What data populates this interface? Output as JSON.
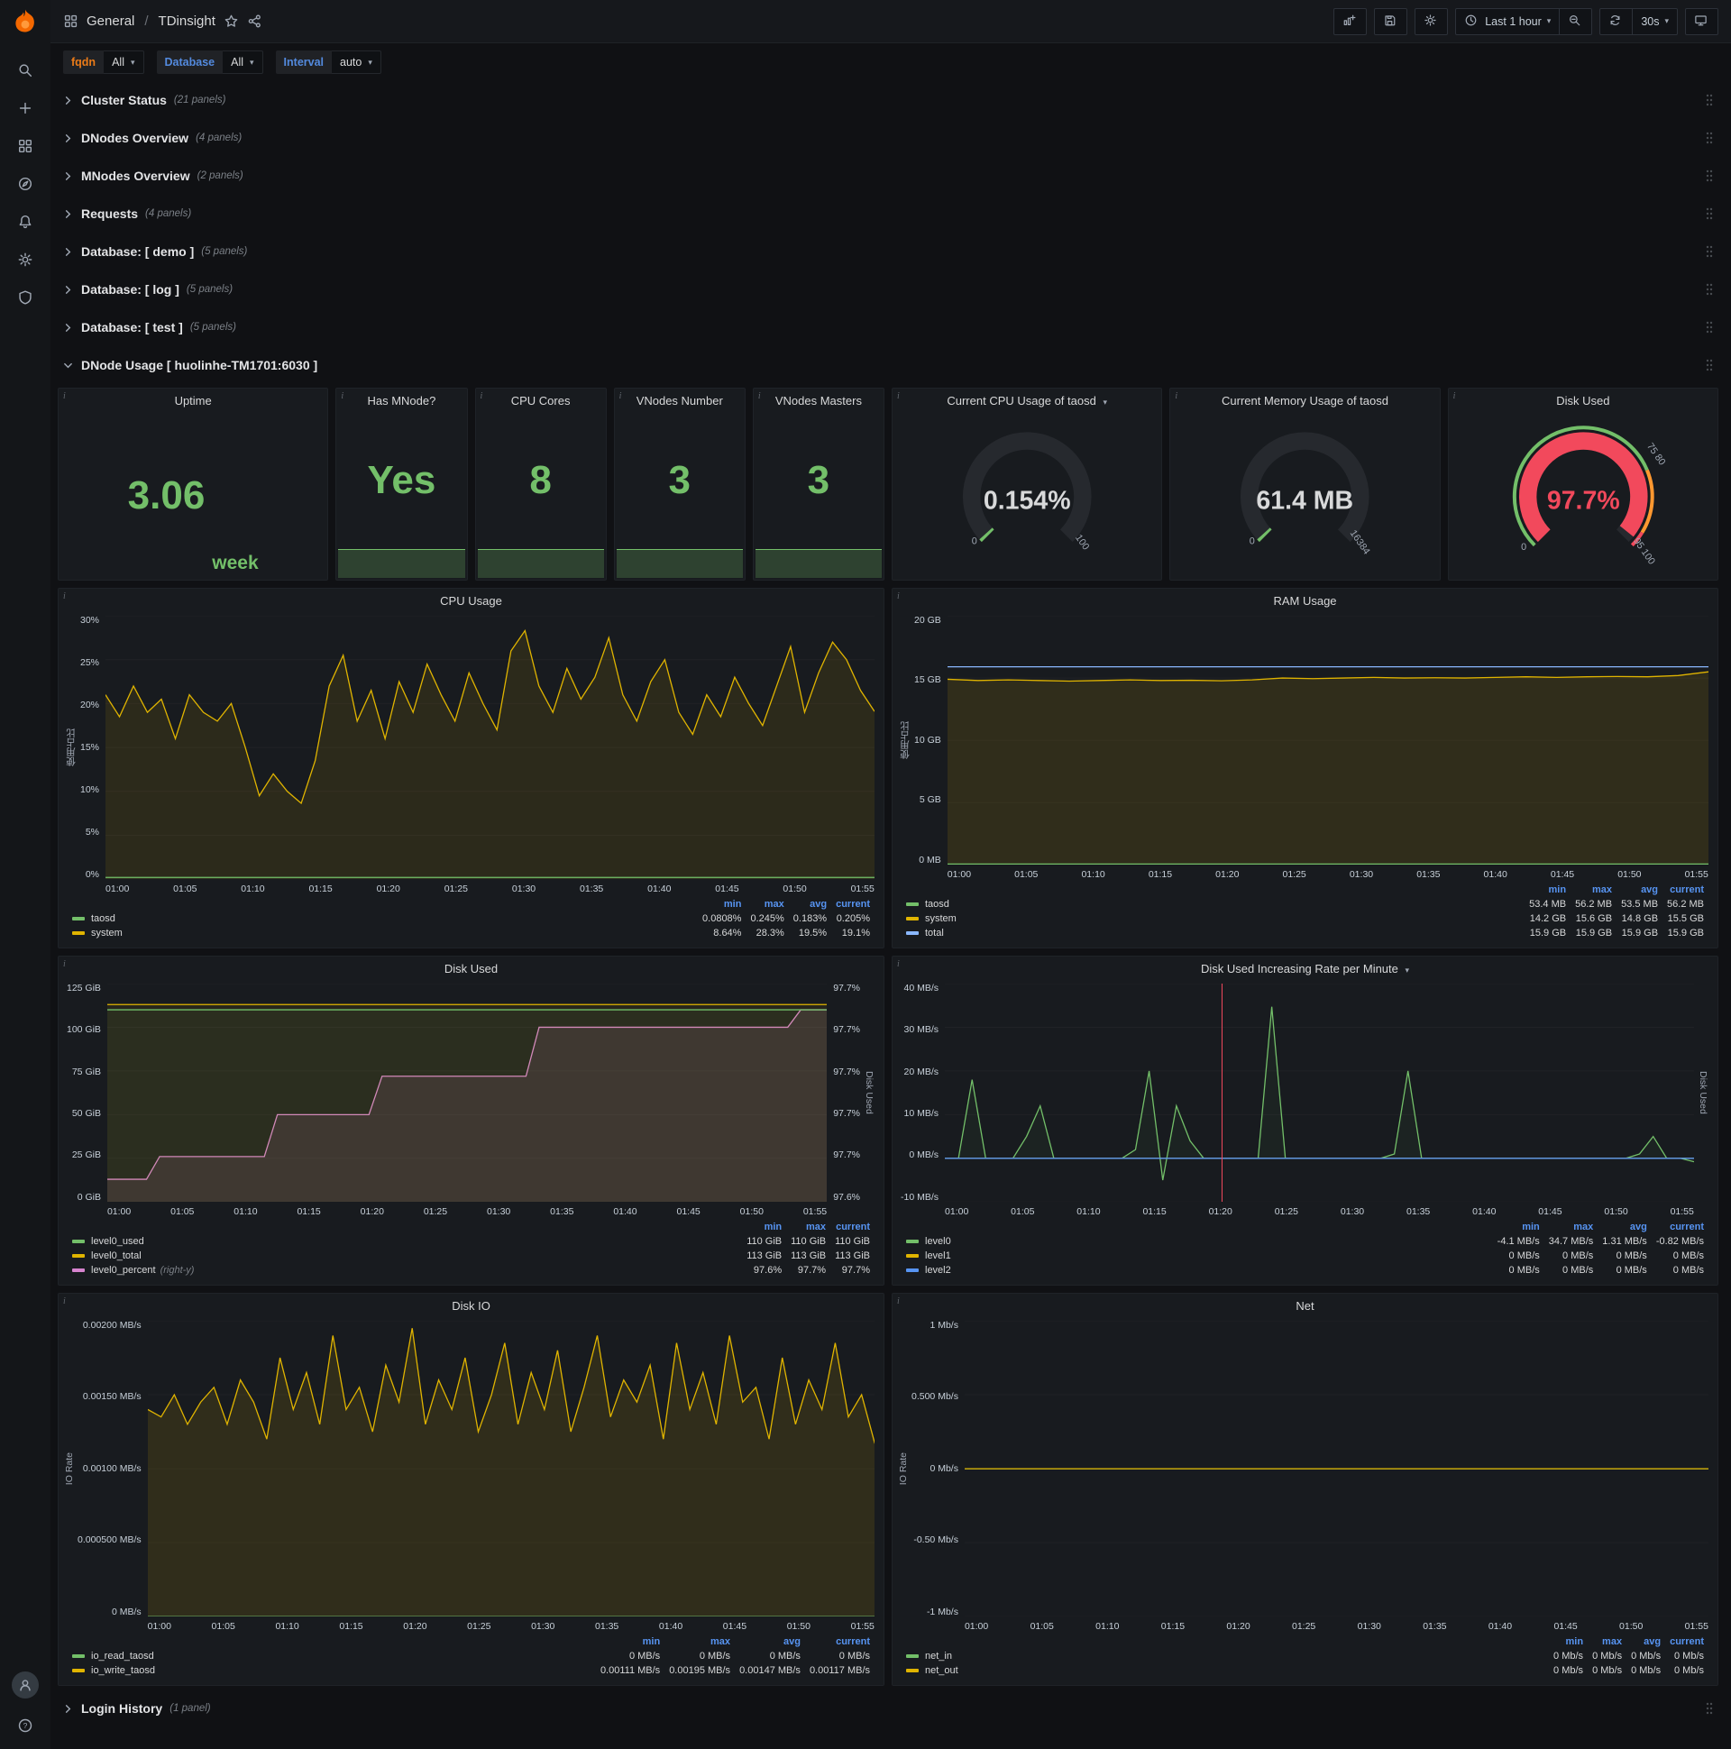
{
  "nav": {
    "section": "General",
    "separator": "/",
    "title": "TDinsight",
    "time_label": "Last 1 hour",
    "refresh_label": "30s"
  },
  "variables": [
    {
      "label": "fqdn",
      "value": "All",
      "color": "#eb7b18"
    },
    {
      "label": "Database",
      "value": "All",
      "color": "#538ade"
    },
    {
      "label": "Interval",
      "value": "auto",
      "color": "#538ade"
    }
  ],
  "sidebar": {
    "top": [
      "search",
      "plus",
      "apps",
      "compass",
      "bell",
      "cog",
      "shield"
    ],
    "bottom": [
      "user",
      "help"
    ]
  },
  "dashboard_rows": [
    {
      "title": "Cluster Status",
      "count": "(21 panels)"
    },
    {
      "title": "DNodes Overview",
      "count": "(4 panels)"
    },
    {
      "title": "MNodes Overview",
      "count": "(2 panels)"
    },
    {
      "title": "Requests",
      "count": "(4 panels)"
    },
    {
      "title": "Database: [ demo ]",
      "count": "(5 panels)"
    },
    {
      "title": "Database: [ log ]",
      "count": "(5 panels)"
    },
    {
      "title": "Database: [ test ]",
      "count": "(5 panels)"
    }
  ],
  "dnode_row": {
    "title": "DNode Usage [ huolinhe-TM1701:6030 ]"
  },
  "login_row": {
    "title": "Login History",
    "count": "(1 panel)"
  },
  "stats": [
    {
      "title": "Uptime",
      "value": "3.06",
      "unit": "week",
      "bar": false
    },
    {
      "title": "Has MNode?",
      "value": "Yes",
      "unit": "",
      "bar": true
    },
    {
      "title": "CPU Cores",
      "value": "8",
      "unit": "",
      "bar": true
    },
    {
      "title": "VNodes Number",
      "value": "3",
      "unit": "",
      "bar": true
    },
    {
      "title": "VNodes Masters",
      "value": "3",
      "unit": "",
      "bar": true
    }
  ],
  "gauges": [
    {
      "title": "Current CPU Usage of taosd",
      "caret": true,
      "value": "0.154%",
      "min_label": "0",
      "max_label": "100",
      "pct": 0.0016,
      "arc_color": "#73bf69",
      "text_color": "#d8d9da",
      "outer": false,
      "threshold_label_mid": "",
      "threshold_label_end": ""
    },
    {
      "title": "Current Memory Usage of taosd",
      "caret": false,
      "value": "61.4 MB",
      "min_label": "0",
      "max_label": "16384",
      "pct": 0.0038,
      "arc_color": "#73bf69",
      "text_color": "#d8d9da",
      "outer": false,
      "threshold_label_mid": "",
      "threshold_label_end": ""
    },
    {
      "title": "Disk Used",
      "caret": false,
      "value": "97.7%",
      "min_label": "0",
      "max_label": "",
      "pct": 0.977,
      "arc_color": "#f2495c",
      "text_color": "#f2495c",
      "outer": true,
      "threshold_label_mid": "75 80",
      "threshold_label_end": "95 100"
    }
  ],
  "x_ticks": [
    "01:00",
    "01:05",
    "01:10",
    "01:15",
    "01:20",
    "01:25",
    "01:30",
    "01:35",
    "01:40",
    "01:45",
    "01:50",
    "01:55"
  ],
  "charts": [
    {
      "title": "CPU Usage",
      "caret": false,
      "y_label": "使用占比",
      "y2_label": "",
      "y_ticks": [
        "30%",
        "25%",
        "20%",
        "15%",
        "10%",
        "5%",
        "0%"
      ],
      "ymin": 0,
      "ymax": 30,
      "series": [
        {
          "name": "system",
          "color": "#e0b400",
          "fill": 0.1,
          "values": [
            21,
            18.5,
            22,
            19,
            20.5,
            16,
            21,
            19,
            18,
            20,
            15,
            9.5,
            12,
            10,
            8.64,
            13.5,
            22,
            25.5,
            18,
            21.5,
            16,
            22.5,
            19,
            24.5,
            21,
            18,
            23.5,
            20,
            17,
            26,
            28.3,
            22,
            19,
            24,
            20.5,
            23,
            27.5,
            21,
            18,
            22.5,
            25,
            19,
            16.5,
            21,
            18.5,
            23,
            20,
            17.5,
            22,
            26.5,
            19,
            23.5,
            27,
            25,
            21.5,
            19.1
          ]
        },
        {
          "name": "taosd",
          "color": "#73bf69",
          "fill": 0.06,
          "values": [
            0.2,
            0.2
          ]
        }
      ],
      "legend": {
        "cols": [
          "min",
          "max",
          "avg",
          "current"
        ],
        "rows": [
          {
            "name": "taosd",
            "color": "#73bf69",
            "suffix": "",
            "values": [
              "0.0808%",
              "0.245%",
              "0.183%",
              "0.205%"
            ]
          },
          {
            "name": "system",
            "color": "#e0b400",
            "suffix": "",
            "values": [
              "8.64%",
              "28.3%",
              "19.5%",
              "19.1%"
            ]
          }
        ]
      }
    },
    {
      "title": "RAM Usage",
      "caret": false,
      "y_label": "使用占比",
      "y2_label": "",
      "y_ticks": [
        "20 GB",
        "15 GB",
        "10 GB",
        "5 GB",
        "0 MB"
      ],
      "ymin": 0,
      "ymax": 20,
      "series": [
        {
          "name": "system",
          "color": "#e0b400",
          "fill": 0.12,
          "values": [
            14.9,
            14.8,
            14.85,
            14.8,
            14.75,
            14.8,
            14.85,
            14.8,
            14.82,
            14.78,
            14.85,
            15,
            14.95,
            15,
            15.05,
            15,
            15.02,
            15,
            15.05,
            15.1,
            15.05,
            15.1,
            15.12,
            15.1,
            15.2,
            15.5
          ]
        },
        {
          "name": "taosd",
          "color": "#73bf69",
          "fill": 0,
          "values": [
            0.06,
            0.06
          ]
        },
        {
          "name": "total",
          "color": "#8ab8ff",
          "fill": 0,
          "values": [
            15.9,
            15.9
          ]
        }
      ],
      "legend": {
        "cols": [
          "min",
          "max",
          "avg",
          "current"
        ],
        "rows": [
          {
            "name": "taosd",
            "color": "#73bf69",
            "suffix": "",
            "values": [
              "53.4 MB",
              "56.2 MB",
              "53.5 MB",
              "56.2 MB"
            ]
          },
          {
            "name": "system",
            "color": "#e0b400",
            "suffix": "",
            "values": [
              "14.2 GB",
              "15.6 GB",
              "14.8 GB",
              "15.5 GB"
            ]
          },
          {
            "name": "total",
            "color": "#8ab8ff",
            "suffix": "",
            "values": [
              "15.9 GB",
              "15.9 GB",
              "15.9 GB",
              "15.9 GB"
            ]
          }
        ]
      }
    },
    {
      "title": "Disk Used",
      "caret": false,
      "y_label": "",
      "y2_label": "Disk Used",
      "y_ticks": [
        "125 GiB",
        "100 GiB",
        "75 GiB",
        "50 GiB",
        "25 GiB",
        "0 GiB"
      ],
      "y2_ticks": [
        "97.7%",
        "97.7%",
        "97.7%",
        "97.7%",
        "97.7%",
        "97.6%"
      ],
      "ymin": 0,
      "ymax": 125,
      "series": [
        {
          "name": "level0_percent",
          "color": "#d683ce",
          "fill": 0.12,
          "values": [
            13,
            13,
            13,
            13,
            26,
            26,
            26,
            26,
            26,
            26,
            26,
            26,
            26,
            50,
            50,
            50,
            50,
            50,
            50,
            50,
            50,
            72,
            72,
            72,
            72,
            72,
            72,
            72,
            72,
            72,
            72,
            72,
            72,
            100,
            100,
            100,
            100,
            100,
            100,
            100,
            100,
            100,
            100,
            100,
            100,
            100,
            100,
            100,
            100,
            100,
            100,
            100,
            100,
            110,
            110,
            110
          ]
        },
        {
          "name": "level0_total",
          "color": "#e0b400",
          "fill": 0.08,
          "values": [
            113,
            113
          ]
        },
        {
          "name": "level0_used",
          "color": "#73bf69",
          "fill": 0.05,
          "values": [
            110,
            110
          ]
        }
      ],
      "legend": {
        "cols": [
          "min",
          "max",
          "current"
        ],
        "rows": [
          {
            "name": "level0_used",
            "color": "#73bf69",
            "suffix": "",
            "values": [
              "110 GiB",
              "110 GiB",
              "110 GiB"
            ]
          },
          {
            "name": "level0_total",
            "color": "#e0b400",
            "suffix": "",
            "values": [
              "113 GiB",
              "113 GiB",
              "113 GiB"
            ]
          },
          {
            "name": "level0_percent",
            "color": "#d683ce",
            "suffix": "(right-y)",
            "values": [
              "97.6%",
              "97.7%",
              "97.7%"
            ]
          }
        ]
      }
    },
    {
      "title": "Disk Used Increasing Rate per Minute",
      "caret": true,
      "y_label": "",
      "y2_label": "Disk Used",
      "y_ticks": [
        "40 MB/s",
        "30 MB/s",
        "20 MB/s",
        "10 MB/s",
        "0 MB/s",
        "-10 MB/s"
      ],
      "ymin": -10,
      "ymax": 40,
      "annotation_x": 37,
      "series": [
        {
          "name": "level0",
          "color": "#73bf69",
          "fill": 0.05,
          "values": [
            0,
            0,
            18,
            0,
            0,
            0,
            5,
            12,
            0,
            0,
            0,
            0,
            0,
            0,
            2,
            20,
            -5,
            12,
            4,
            0,
            0,
            0,
            0,
            0,
            34.7,
            0,
            0,
            0,
            0,
            0,
            0,
            0,
            0,
            1,
            20,
            0,
            0,
            0,
            0,
            0,
            0,
            0,
            0,
            0,
            0,
            0,
            0,
            0,
            0,
            0,
            0,
            1,
            5,
            0,
            0,
            -0.8
          ]
        },
        {
          "name": "level1",
          "color": "#e0b400",
          "fill": 0,
          "values": [
            0,
            0
          ]
        },
        {
          "name": "level2",
          "color": "#5794f2",
          "fill": 0,
          "values": [
            0,
            0
          ]
        }
      ],
      "legend": {
        "cols": [
          "min",
          "max",
          "avg",
          "current"
        ],
        "rows": [
          {
            "name": "level0",
            "color": "#73bf69",
            "suffix": "",
            "values": [
              "-4.1 MB/s",
              "34.7 MB/s",
              "1.31 MB/s",
              "-0.82 MB/s"
            ]
          },
          {
            "name": "level1",
            "color": "#e0b400",
            "suffix": "",
            "values": [
              "0 MB/s",
              "0 MB/s",
              "0 MB/s",
              "0 MB/s"
            ]
          },
          {
            "name": "level2",
            "color": "#5794f2",
            "suffix": "",
            "values": [
              "0 MB/s",
              "0 MB/s",
              "0 MB/s",
              "0 MB/s"
            ]
          }
        ]
      }
    },
    {
      "title": "Disk IO",
      "caret": false,
      "y_label": "IO Rate",
      "y2_label": "",
      "y_ticks": [
        "0.00200 MB/s",
        "0.00150 MB/s",
        "0.00100 MB/s",
        "0.000500 MB/s",
        "0 MB/s"
      ],
      "ymin": 0,
      "ymax": 0.002,
      "series": [
        {
          "name": "io_write_taosd",
          "color": "#e0b400",
          "fill": 0.12,
          "values": [
            0.0014,
            0.00135,
            0.0015,
            0.0013,
            0.00145,
            0.00155,
            0.0013,
            0.0016,
            0.00145,
            0.0012,
            0.00175,
            0.0014,
            0.00165,
            0.0013,
            0.0019,
            0.0014,
            0.00155,
            0.00125,
            0.0017,
            0.00145,
            0.00195,
            0.0013,
            0.0016,
            0.0014,
            0.00175,
            0.00125,
            0.0015,
            0.00185,
            0.0013,
            0.00165,
            0.0014,
            0.0018,
            0.00125,
            0.00155,
            0.0019,
            0.00135,
            0.0016,
            0.00145,
            0.0017,
            0.0012,
            0.00185,
            0.0014,
            0.00165,
            0.0013,
            0.0019,
            0.00145,
            0.00155,
            0.0012,
            0.00175,
            0.0013,
            0.0016,
            0.0014,
            0.00185,
            0.00135,
            0.0015,
            0.00117
          ]
        },
        {
          "name": "io_read_taosd",
          "color": "#73bf69",
          "fill": 0,
          "values": [
            0,
            0
          ]
        }
      ],
      "legend": {
        "cols": [
          "min",
          "max",
          "avg",
          "current"
        ],
        "rows": [
          {
            "name": "io_read_taosd",
            "color": "#73bf69",
            "suffix": "",
            "values": [
              "0 MB/s",
              "0 MB/s",
              "0 MB/s",
              "0 MB/s"
            ]
          },
          {
            "name": "io_write_taosd",
            "color": "#e0b400",
            "suffix": "",
            "values": [
              "0.00111 MB/s",
              "0.00195 MB/s",
              "0.00147 MB/s",
              "0.00117 MB/s"
            ]
          }
        ]
      }
    },
    {
      "title": "Net",
      "caret": false,
      "y_label": "IO Rate",
      "y2_label": "",
      "y_ticks": [
        "1 Mb/s",
        "0.500 Mb/s",
        "0 Mb/s",
        "-0.50 Mb/s",
        "-1 Mb/s"
      ],
      "ymin": -1,
      "ymax": 1,
      "series": [
        {
          "name": "net_in",
          "color": "#73bf69",
          "fill": 0,
          "values": [
            0,
            0
          ]
        },
        {
          "name": "net_out",
          "color": "#e0b400",
          "fill": 0,
          "values": [
            0,
            0
          ]
        }
      ],
      "legend": {
        "cols": [
          "min",
          "max",
          "avg",
          "current"
        ],
        "rows": [
          {
            "name": "net_in",
            "color": "#73bf69",
            "suffix": "",
            "values": [
              "0 Mb/s",
              "0 Mb/s",
              "0 Mb/s",
              "0 Mb/s"
            ]
          },
          {
            "name": "net_out",
            "color": "#e0b400",
            "suffix": "",
            "values": [
              "0 Mb/s",
              "0 Mb/s",
              "0 Mb/s",
              "0 Mb/s"
            ]
          }
        ]
      }
    }
  ]
}
